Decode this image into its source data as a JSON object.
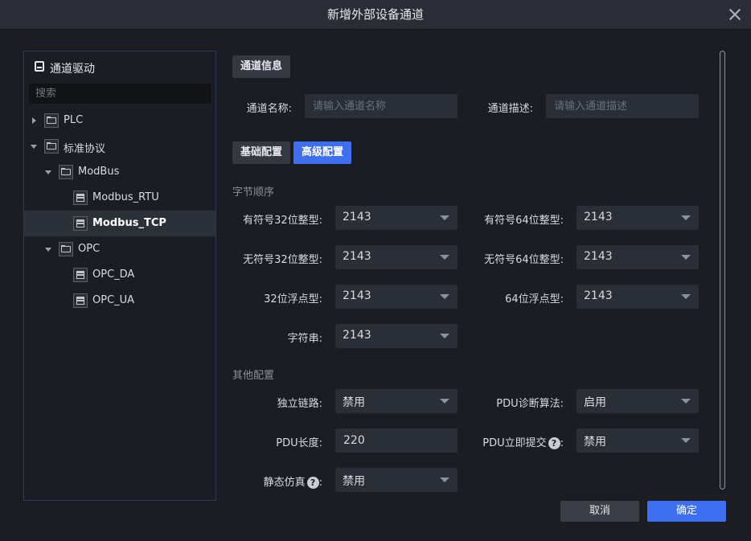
{
  "dialog": {
    "title": "新增外部设备通道"
  },
  "left_panel": {
    "title": "通道驱动",
    "search_placeholder": "搜索",
    "tree": [
      {
        "label": "PLC"
      },
      {
        "label": "标准协议"
      },
      {
        "label": "ModBus"
      },
      {
        "label": "Modbus_RTU"
      },
      {
        "label": "Modbus_TCP",
        "selected": true
      },
      {
        "label": "OPC"
      },
      {
        "label": "OPC_DA"
      },
      {
        "label": "OPC_UA"
      }
    ]
  },
  "channel_info": {
    "section": "通道信息",
    "name_label": "通道名称:",
    "name_placeholder": "请输入通道名称",
    "desc_label": "通道描述:",
    "desc_placeholder": "请输入通道描述"
  },
  "tabs": [
    {
      "label": "基础配置"
    },
    {
      "label": "高级配置",
      "active": true
    }
  ],
  "byte_order": {
    "heading": "字节顺序",
    "fields": [
      {
        "label": "有符号32位整型:",
        "value": "2143"
      },
      {
        "label": "有符号64位整型:",
        "value": "2143"
      },
      {
        "label": "无符号32位整型:",
        "value": "2143"
      },
      {
        "label": "无符号64位整型:",
        "value": "2143"
      },
      {
        "label": "32位浮点型:",
        "value": "2143"
      },
      {
        "label": "64位浮点型:",
        "value": "2143"
      },
      {
        "label": "字符串:",
        "value": "2143"
      }
    ]
  },
  "other": {
    "heading": "其他配置",
    "independent_link": {
      "label": "独立链路:",
      "value": "禁用"
    },
    "pdu_algo": {
      "label": "PDU诊断算法:",
      "value": "启用"
    },
    "pdu_length": {
      "label": "PDU长度:",
      "value": "220"
    },
    "pdu_submit": {
      "label": "PDU立即提交",
      "value": "禁用"
    },
    "static_sim": {
      "label": "静态仿真",
      "value": "禁用"
    },
    "help_glyph": "?",
    "colon": ":"
  },
  "buttons": {
    "cancel": "取消",
    "ok": "确定"
  },
  "colors": {
    "accent": "#3d6ff0",
    "background": "#1b1d23"
  }
}
